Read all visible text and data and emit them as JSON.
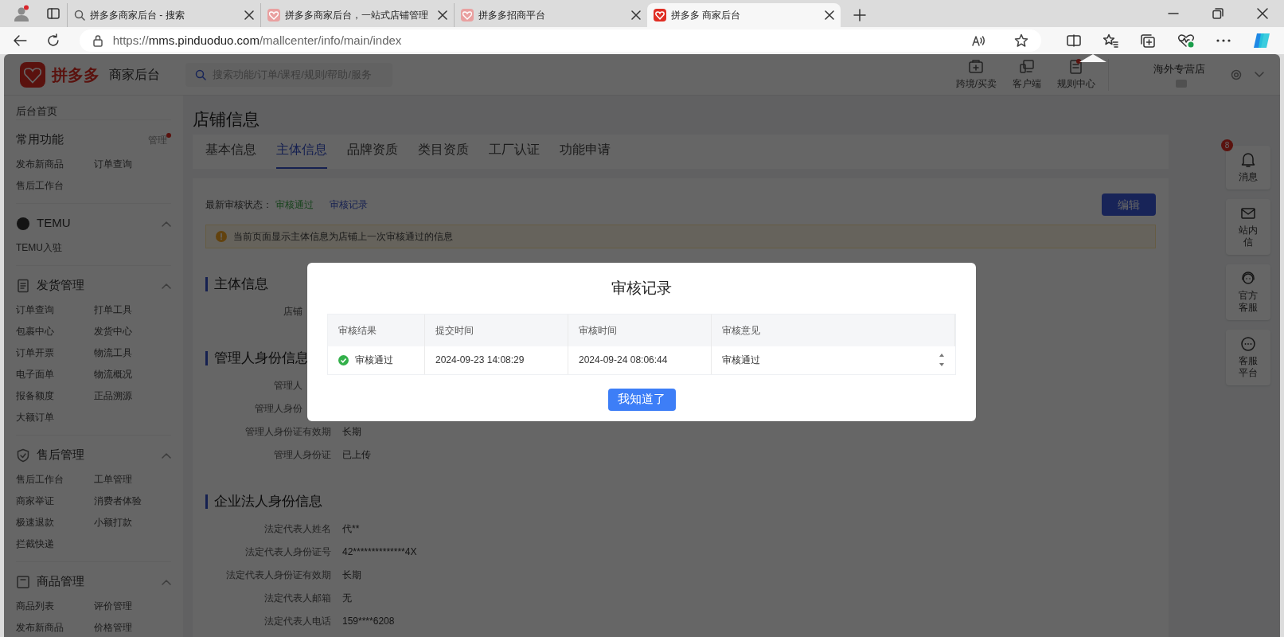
{
  "browser": {
    "tabs": [
      {
        "title": "拼多多商家后台 - 搜索",
        "kind": "search",
        "selected": false
      },
      {
        "title": "拼多多商家后台，一站式店铺管理",
        "kind": "site",
        "selected": false
      },
      {
        "title": "拼多多招商平台",
        "kind": "site",
        "selected": false
      },
      {
        "title": "拼多多 商家后台",
        "kind": "site",
        "selected": true
      }
    ],
    "url": {
      "scheme": "https://",
      "host": "mms.pinduoduo.com",
      "path": "/mallcenter/info/main/index"
    }
  },
  "header": {
    "logo_text": "拼多多",
    "subtitle": "商家后台",
    "search_placeholder": "搜索功能/订单/课程/规则/帮助/服务",
    "tools": [
      {
        "label": "跨境/买卖",
        "kind": "cross",
        "badge": false
      },
      {
        "label": "客户端",
        "kind": "client",
        "badge": false
      },
      {
        "label": "规则中心",
        "kind": "rules",
        "badge": true
      }
    ],
    "store_name": "海外专营店"
  },
  "sidebar": {
    "home": "后台首页",
    "sections": [
      {
        "title": "常用功能",
        "kind": "plain",
        "action": "管理",
        "items": [
          "发布新商品",
          "订单查询",
          "售后工作台"
        ]
      },
      {
        "title": "TEMU",
        "kind": "temu",
        "expanded": true,
        "items": [
          "TEMU入驻"
        ]
      },
      {
        "title": "发货管理",
        "kind": "doc",
        "expanded": true,
        "items": [
          "订单查询",
          "打单工具",
          "包裹中心",
          "发货中心",
          "订单开票",
          "物流工具",
          "电子面单",
          "物流概况",
          "报备额度",
          "正品溯源",
          "大额订单"
        ]
      },
      {
        "title": "售后管理",
        "kind": "shield",
        "expanded": true,
        "items": [
          "售后工作台",
          "工单管理",
          "商家举证",
          "消费者体验",
          "极速退款",
          "小额打款",
          "拦截快递"
        ]
      },
      {
        "title": "商品管理",
        "kind": "box",
        "expanded": true,
        "items": [
          "商品列表",
          "评价管理",
          "发布新商品",
          "价格管理"
        ]
      }
    ]
  },
  "main": {
    "title": "店铺信息",
    "tabs": [
      {
        "label": "基本信息",
        "selected": false
      },
      {
        "label": "主体信息",
        "selected": true
      },
      {
        "label": "品牌资质",
        "selected": false
      },
      {
        "label": "类目资质",
        "selected": false
      },
      {
        "label": "工厂认证",
        "selected": false
      },
      {
        "label": "功能申请",
        "selected": false
      }
    ],
    "status_label": "最新审核状态：",
    "status": "审核通过",
    "record_link": "审核记录",
    "edit_button": "编辑",
    "notice": "当前页面显示主体信息为店铺上一次审核通过的信息",
    "sections": [
      {
        "title": "主体信息",
        "rows": [
          {
            "label": "店铺"
          }
        ]
      },
      {
        "title": "管理人身份信息",
        "rows": [
          {
            "label": "管理人"
          },
          {
            "label": "管理人身份"
          },
          {
            "label": "管理人身份证有效期",
            "value": "长期"
          },
          {
            "label": "管理人身份证",
            "value": "已上传"
          }
        ]
      },
      {
        "title": "企业法人身份信息",
        "rows": [
          {
            "label": "法定代表人姓名",
            "value": "代**"
          },
          {
            "label": "法定代表人身份证号",
            "value": "42**************4X"
          },
          {
            "label": "法定代表人身份证有效期",
            "value": "长期"
          },
          {
            "label": "法定代表人邮箱",
            "value": "无"
          },
          {
            "label": "法定代表人电话",
            "value": "159****6208"
          }
        ]
      }
    ]
  },
  "float_buttons": [
    {
      "label": "消息",
      "kind": "bell",
      "badge": "8"
    },
    {
      "label": "站内信",
      "kind": "mail"
    },
    {
      "label": "官方客服",
      "kind": "service"
    },
    {
      "label": "客服平台",
      "kind": "chat"
    }
  ],
  "modal": {
    "title": "审核记录",
    "columns": [
      "审核结果",
      "提交时间",
      "审核时间",
      "审核意见"
    ],
    "rows": [
      {
        "result": "审核通过",
        "passed": true,
        "submitted": "2024-09-23 14:08:29",
        "reviewed": "2024-09-24 08:06:44",
        "opinion": "审核通过"
      }
    ],
    "button": "我知道了"
  }
}
